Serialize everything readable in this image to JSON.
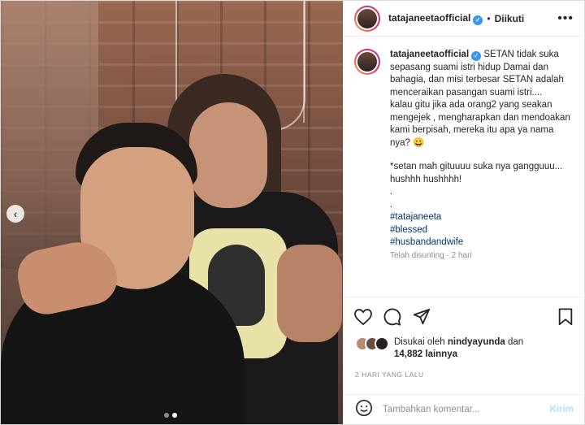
{
  "post": {
    "username": "tatajaneetaofficial",
    "follow_separator": "•",
    "follow_label": "Diikuti",
    "more_label": "•••",
    "caption_lines": [
      "SETAN tidak suka sepasang suami istri hidup Damai dan bahagia, dan misi terbesar SETAN adalah menceraikan pasangan suami istri....",
      "kalau gitu jika ada orang2 yang seakan mengejek , mengharapkan dan mendoakan kami berpisah, mereka itu apa ya nama nya? 😀",
      "*setan mah gituuuu suka nya gangguuu... hushhh hushhhh!",
      ".",
      "."
    ],
    "hashtags": [
      "#tatajaneeta",
      "#blessed",
      "#husbandandwife"
    ],
    "edited_label": "Telah disunting · 2 hari",
    "liked_by_prefix": "Disukai oleh",
    "liked_by_user": "nindyayunda",
    "liked_by_and": "dan",
    "like_count": "14,882 lainnya",
    "timestamp": "2 HARI YANG LALU",
    "comment_placeholder": "Tambahkan komentar...",
    "post_button": "Kirim"
  },
  "icons": {
    "verified": "verified-badge-icon",
    "like": "heart-icon",
    "comment": "comment-icon",
    "share": "share-icon",
    "save": "bookmark-icon",
    "emoji": "emoji-icon",
    "prev": "chevron-left-icon"
  },
  "carousel": {
    "total": 2,
    "active": 2
  },
  "colors": {
    "link": "#00376b",
    "verified": "#3897f0",
    "post_button_disabled": "#b2dffc"
  }
}
